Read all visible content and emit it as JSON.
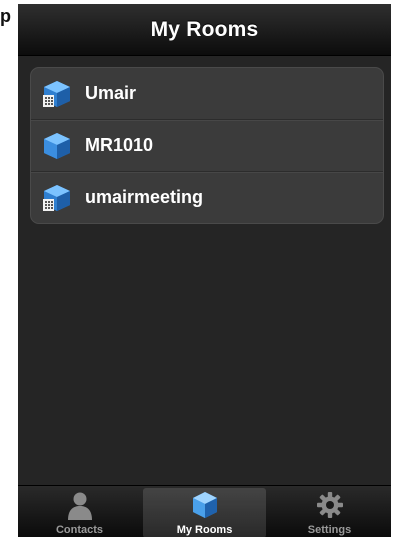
{
  "corner_label": "p",
  "navbar": {
    "title": "My Rooms"
  },
  "rooms": [
    {
      "name": "Umair",
      "icon": "room-building-icon"
    },
    {
      "name": "MR1010",
      "icon": "room-cube-icon"
    },
    {
      "name": "umairmeeting",
      "icon": "room-building-icon"
    }
  ],
  "tabbar": {
    "tabs": [
      {
        "label": "Contacts",
        "icon": "person-icon",
        "active": false
      },
      {
        "label": "My Rooms",
        "icon": "cube-icon",
        "active": true
      },
      {
        "label": "Settings",
        "icon": "gear-icon",
        "active": false
      }
    ]
  },
  "colors": {
    "accent": "#3a8fd8",
    "background": "#252525",
    "list_bg": "#3b3b3b"
  }
}
